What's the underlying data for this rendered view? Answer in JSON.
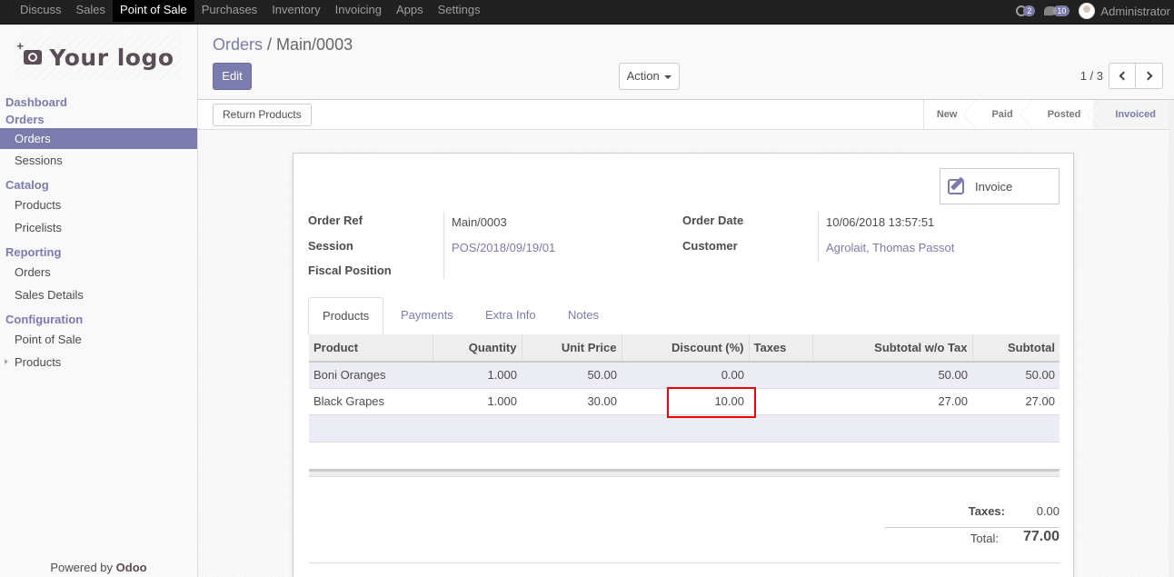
{
  "topbar": {
    "apps": [
      "Discuss",
      "Sales",
      "Point of Sale",
      "Purchases",
      "Inventory",
      "Invoicing",
      "Apps",
      "Settings"
    ],
    "active_app": "Point of Sale",
    "activity_count": "2",
    "messages_count": "10",
    "user_name": "Administrator"
  },
  "sidebar": {
    "logo_text": "Your logo",
    "sections": [
      {
        "label": "Dashboard",
        "items": []
      },
      {
        "label": "Orders",
        "items": [
          {
            "label": "Orders",
            "active": true
          },
          {
            "label": "Sessions"
          }
        ]
      },
      {
        "label": "Catalog",
        "items": [
          {
            "label": "Products"
          },
          {
            "label": "Pricelists"
          }
        ]
      },
      {
        "label": "Reporting",
        "items": [
          {
            "label": "Orders"
          },
          {
            "label": "Sales Details"
          }
        ]
      },
      {
        "label": "Configuration",
        "items": [
          {
            "label": "Point of Sale"
          },
          {
            "label": "Products",
            "expandable": true
          }
        ]
      }
    ],
    "powered_by": "Powered by",
    "powered_brand": "Odoo"
  },
  "control": {
    "breadcrumb_parent": "Orders",
    "breadcrumb_sep": " / ",
    "breadcrumb_current": "Main/0003",
    "edit_label": "Edit",
    "action_label": "Action",
    "pager": "1 / 3"
  },
  "statusbar": {
    "return_label": "Return Products",
    "states": [
      "New",
      "Paid",
      "Posted",
      "Invoiced"
    ],
    "current_state": "Invoiced"
  },
  "form": {
    "invoice_button": "Invoice",
    "order_ref_label": "Order Ref",
    "order_ref": "Main/0003",
    "session_label": "Session",
    "session": "POS/2018/09/19/01",
    "fiscal_position_label": "Fiscal Position",
    "fiscal_position": "",
    "order_date_label": "Order Date",
    "order_date": "10/06/2018 13:57:51",
    "customer_label": "Customer",
    "customer": "Agrolait, Thomas Passot",
    "tabs": [
      "Products",
      "Payments",
      "Extra Info",
      "Notes"
    ],
    "active_tab": "Products",
    "columns": [
      "Product",
      "Quantity",
      "Unit Price",
      "Discount (%)",
      "Taxes",
      "Subtotal w/o Tax",
      "Subtotal"
    ],
    "lines": [
      {
        "product": "Boni Oranges",
        "quantity": "1.000",
        "unit_price": "50.00",
        "discount": "0.00",
        "taxes": "",
        "subtotal_wo_tax": "50.00",
        "subtotal": "50.00"
      },
      {
        "product": "Black Grapes",
        "quantity": "1.000",
        "unit_price": "30.00",
        "discount": "10.00",
        "taxes": "",
        "subtotal_wo_tax": "27.00",
        "subtotal": "27.00"
      }
    ],
    "taxes_label": "Taxes:",
    "taxes_value": "0.00",
    "total_label": "Total:",
    "total_value": "77.00"
  },
  "colors": {
    "brand": "#7c7bad",
    "navbar": "#212121",
    "highlight": "#e00000"
  }
}
